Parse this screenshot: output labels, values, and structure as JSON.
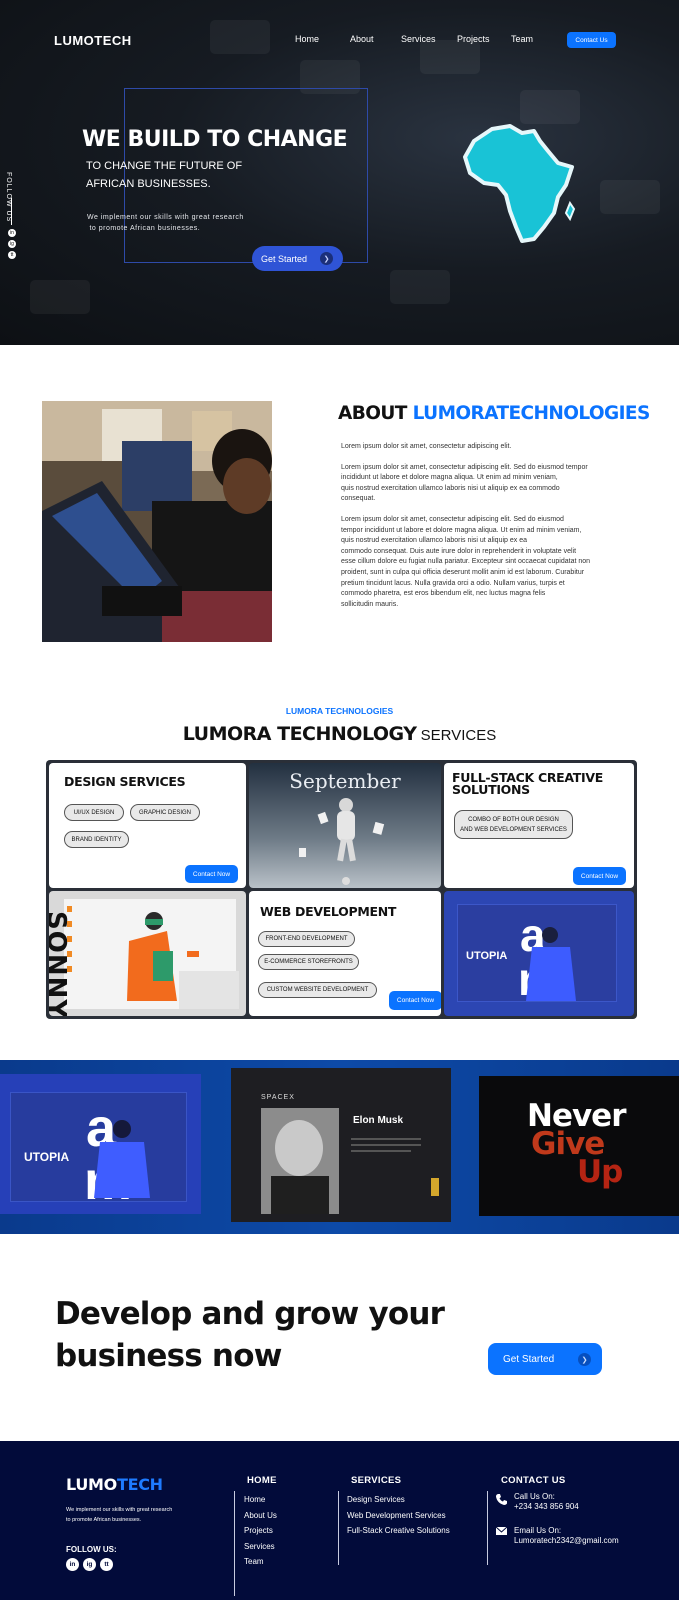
{
  "header": {
    "logo": "LUMOTECH",
    "nav": [
      "Home",
      "About",
      "Services",
      "Projects",
      "Team"
    ],
    "contact_button": "Contact Us"
  },
  "hero": {
    "title": "WE BUILD TO CHANGE",
    "subtitle_line1": "TO CHANGE THE FUTURE OF",
    "subtitle_line2": "AFRICAN BUSINESSES.",
    "desc_line1": "We implement our skills with great research",
    "desc_line2": " to promote African businesses.",
    "cta": "Get Started",
    "follow_label": "FOLLOW US",
    "social": [
      "in",
      "ig",
      "tt"
    ]
  },
  "about": {
    "title_plain": "ABOUT ",
    "title_accent": "LUMORATECHNOLOGIES",
    "paragraphs": [
      "Lorem ipsum dolor sit amet, consectetur adipiscing elit.",
      "Lorem ipsum dolor sit amet, consectetur adipiscing elit. Sed do eiusmod tempor\n incididunt ut labore et dolore magna aliqua. Ut enim ad minim veniam,\n quis nostrud exercitation ullamco laboris nisi ut aliquip ex ea commodo\n consequat.",
      "Lorem ipsum dolor sit amet, consectetur adipiscing elit. Sed do eiusmod\ntempor incididunt ut labore et dolore magna aliqua. Ut enim ad minim veniam,\nquis nostrud exercitation ullamco laboris nisi ut aliquip ex ea\ncommodo consequat. Duis aute irure dolor in reprehenderit in voluptate velit\nesse cillum dolore eu fugiat nulla pariatur. Excepteur sint occaecat cupidatat non\nproident, sunt in culpa qui officia deserunt mollit anim id est laborum. Curabitur\npretium tincidunt lacus. Nulla gravida orci a odio. Nullam varius, turpis et\ncommodo pharetra, est eros bibendum elit, nec luctus magna felis\nsollicitudin mauris."
    ]
  },
  "services": {
    "kicker": "LUMORA TECHNOLOGIES",
    "title_bold": "LUMORA TECHNOLOGY",
    "title_light": " SERVICES",
    "design": {
      "title": "DESIGN SERVICES",
      "tags": [
        "UI/UX DESIGN",
        "GRAPHIC DESIGN",
        "BRAND IDENTITY"
      ],
      "button": "Contact Now"
    },
    "fullstack": {
      "title_line1": "FULL-STACK CREATIVE",
      "title_line2": "SOLUTIONS",
      "tag_line1": "COMBO OF BOTH OUR DESIGN",
      "tag_line2": "AND WEB DEVELOPMENT SERVICES",
      "button": "Contact Now"
    },
    "web": {
      "title": "WEB DEVELOPMENT",
      "tags": [
        "FRONT-END DEVELOPMENT",
        "E-COMMERCE STOREFRONTS",
        "CUSTOM WEBSITE DEVELOPMENT"
      ],
      "button": "Contact Now"
    },
    "mockups": {
      "september": "September",
      "sonny": "SONNY",
      "utopia": "UTOPIA"
    }
  },
  "showcase": {
    "utopia": "UTOPIA",
    "spacex": "SPACEX",
    "elon": "Elon Musk",
    "never": "Never",
    "give": "Give",
    "up": "Up"
  },
  "cta": {
    "line1": "Develop and grow your",
    "line2": "business now",
    "button": "Get Started"
  },
  "footer": {
    "logo_part1": "LUMO",
    "logo_part2": "TECH",
    "desc": "We implement our skills with great research\n to promote African businesses.",
    "follow": "FOLLOW US:",
    "social": [
      "in",
      "ig",
      "tt"
    ],
    "home_heading": "HOME",
    "home_links": [
      "Home",
      "About Us",
      "Projects",
      "Services",
      "Team"
    ],
    "services_heading": "SERVICES",
    "services_links": [
      "Design Services",
      "Web Development Services",
      "Full-Stack Creative Solutions"
    ],
    "contact_heading": "CONTACT US",
    "call_label": "Call Us On:",
    "call_value": "+234 343 856 904",
    "email_label": "Email Us On:",
    "email_value": "Lumoratech2342@gmail.com"
  },
  "colors": {
    "accent": "#0b73ff",
    "hero_button": "#2f54d6",
    "footer_bg": "#020b3a",
    "africa": "#19c3d6"
  }
}
